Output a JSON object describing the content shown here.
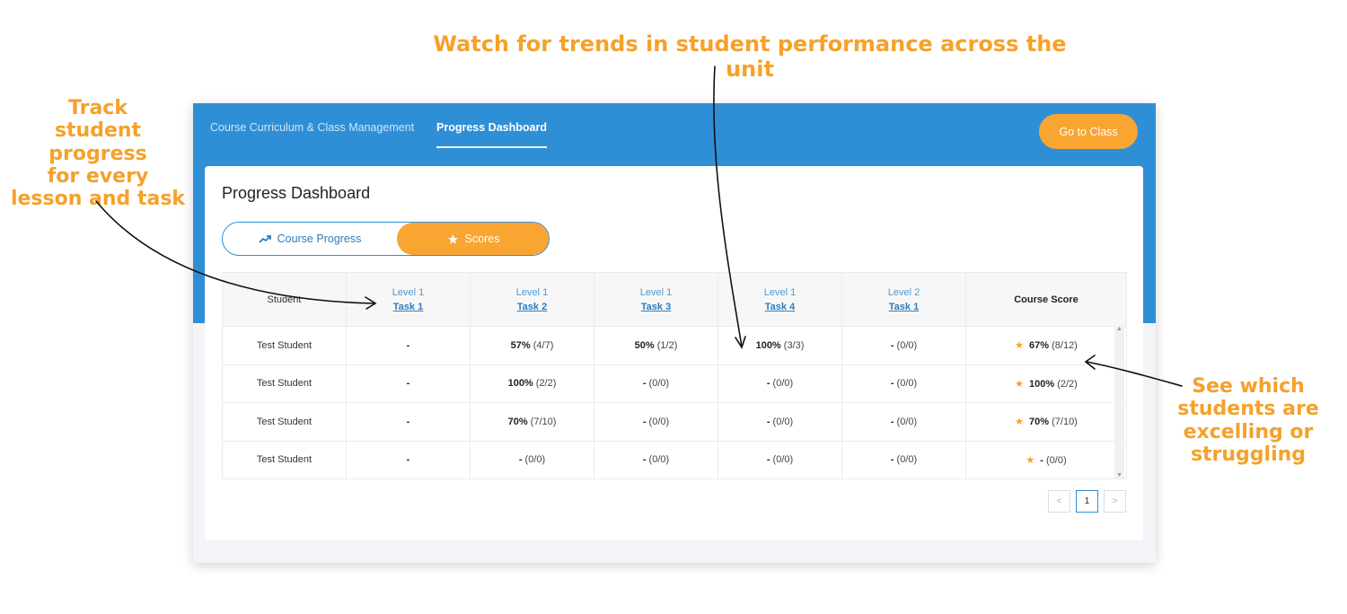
{
  "annotations": {
    "top": "Watch for trends in student performance across the unit",
    "left": [
      "Track",
      "student progress",
      "for every",
      "lesson and task"
    ],
    "right": [
      "See which",
      "students are",
      "excelling or",
      "struggling"
    ]
  },
  "header": {
    "tabs": [
      "Course Curriculum & Class Management",
      "Progress Dashboard"
    ],
    "active_tab": "Progress Dashboard",
    "go_button": "Go to Class"
  },
  "page_title": "Progress Dashboard",
  "toggle": {
    "options": [
      {
        "label": "Course Progress",
        "icon": "trending-up-icon"
      },
      {
        "label": "Scores",
        "icon": "star-icon"
      }
    ],
    "selected": "Scores"
  },
  "table": {
    "student_header": "Student",
    "columns": [
      {
        "level": "Level 1",
        "task": "Task 1"
      },
      {
        "level": "Level 1",
        "task": "Task 2"
      },
      {
        "level": "Level 1",
        "task": "Task 3"
      },
      {
        "level": "Level 1",
        "task": "Task 4"
      },
      {
        "level": "Level 2",
        "task": "Task 1"
      }
    ],
    "course_header": "Course Score",
    "rows": [
      {
        "student": "Test Student",
        "cells": [
          {
            "pct": "-",
            "frac": ""
          },
          {
            "pct": "57%",
            "frac": "(4/7)"
          },
          {
            "pct": "50%",
            "frac": "(1/2)"
          },
          {
            "pct": "100%",
            "frac": "(3/3)"
          },
          {
            "pct": "-",
            "frac": "(0/0)"
          }
        ],
        "course": {
          "pct": "67%",
          "frac": "(8/12)"
        }
      },
      {
        "student": "Test Student",
        "cells": [
          {
            "pct": "-",
            "frac": ""
          },
          {
            "pct": "100%",
            "frac": "(2/2)"
          },
          {
            "pct": "-",
            "frac": "(0/0)"
          },
          {
            "pct": "-",
            "frac": "(0/0)"
          },
          {
            "pct": "-",
            "frac": "(0/0)"
          }
        ],
        "course": {
          "pct": "100%",
          "frac": "(2/2)"
        }
      },
      {
        "student": "Test Student",
        "cells": [
          {
            "pct": "-",
            "frac": ""
          },
          {
            "pct": "70%",
            "frac": "(7/10)"
          },
          {
            "pct": "-",
            "frac": "(0/0)"
          },
          {
            "pct": "-",
            "frac": "(0/0)"
          },
          {
            "pct": "-",
            "frac": "(0/0)"
          }
        ],
        "course": {
          "pct": "70%",
          "frac": "(7/10)"
        }
      },
      {
        "student": "Test Student",
        "cells": [
          {
            "pct": "-",
            "frac": ""
          },
          {
            "pct": "-",
            "frac": "(0/0)"
          },
          {
            "pct": "-",
            "frac": "(0/0)"
          },
          {
            "pct": "-",
            "frac": "(0/0)"
          },
          {
            "pct": "-",
            "frac": "(0/0)"
          }
        ],
        "course": {
          "pct": "-",
          "frac": "(0/0)"
        }
      }
    ]
  },
  "pagination": {
    "prev": "<",
    "current": "1",
    "next": ">"
  },
  "colors": {
    "primary_blue": "#2f8fd6",
    "accent_orange": "#f9a531",
    "annotation_orange": "#f5a12a"
  }
}
